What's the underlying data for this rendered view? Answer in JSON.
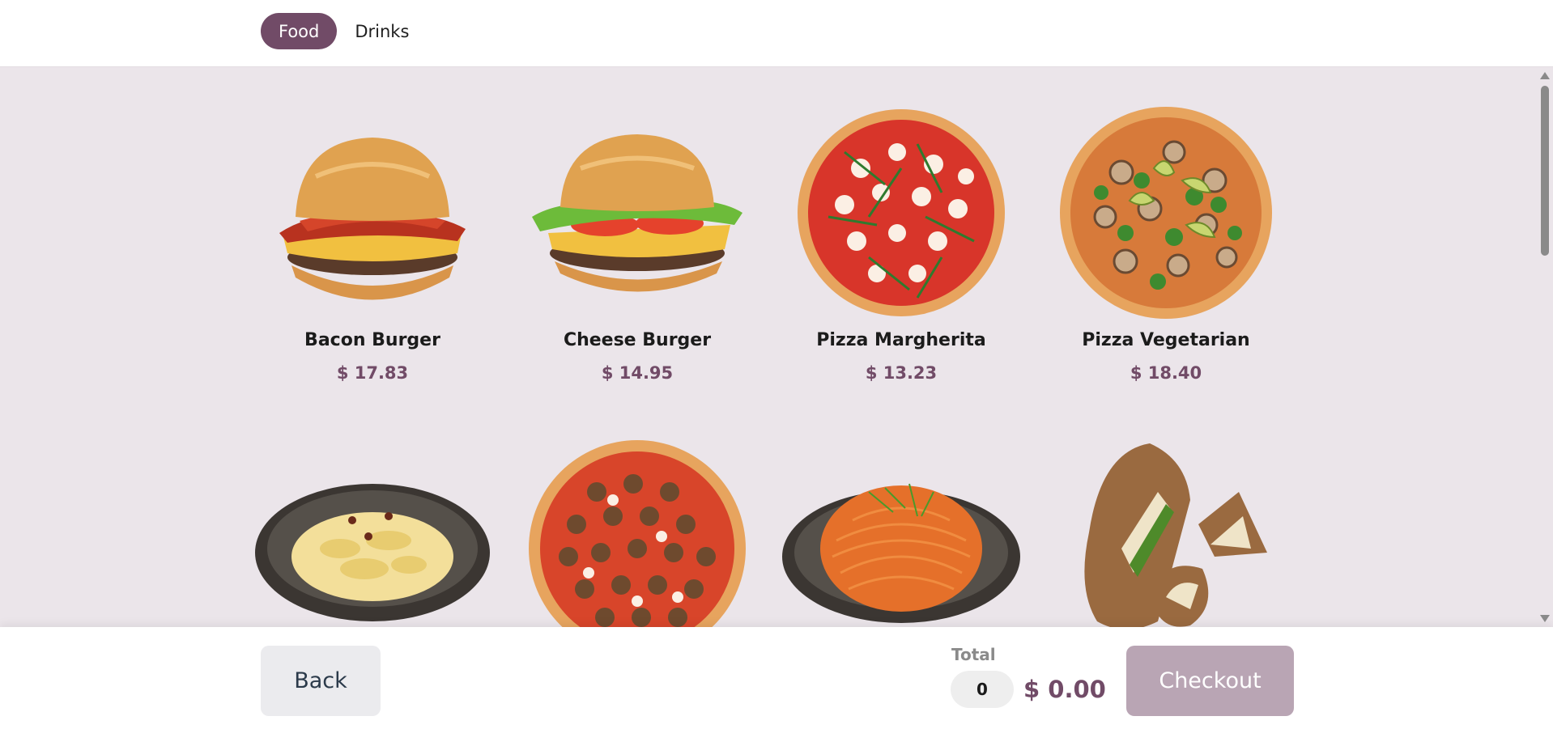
{
  "header": {
    "tabs": [
      {
        "label": "Food",
        "active": true
      },
      {
        "label": "Drinks",
        "active": false
      }
    ]
  },
  "products": [
    {
      "name": "Bacon Burger",
      "price": "$ 17.83",
      "icon": "bacon-burger-image"
    },
    {
      "name": "Cheese Burger",
      "price": "$ 14.95",
      "icon": "cheese-burger-image"
    },
    {
      "name": "Pizza Margherita",
      "price": "$ 13.23",
      "icon": "pizza-margherita-image"
    },
    {
      "name": "Pizza Vegetarian",
      "price": "$ 18.40",
      "icon": "pizza-vegetarian-image"
    },
    {
      "name": "",
      "price": "",
      "icon": "pasta-bowl-image"
    },
    {
      "name": "",
      "price": "",
      "icon": "mushroom-pizza-image"
    },
    {
      "name": "",
      "price": "",
      "icon": "spaghetti-bowl-image"
    },
    {
      "name": "",
      "price": "",
      "icon": "sandwich-image"
    }
  ],
  "footer": {
    "back_label": "Back",
    "total_label": "Total",
    "quantity": "0",
    "total_amount": "$ 0.00",
    "checkout_label": "Checkout"
  },
  "colors": {
    "accent": "#714b67",
    "content_bg": "#ebe5ea",
    "checkout_disabled": "#b9a5b4"
  }
}
